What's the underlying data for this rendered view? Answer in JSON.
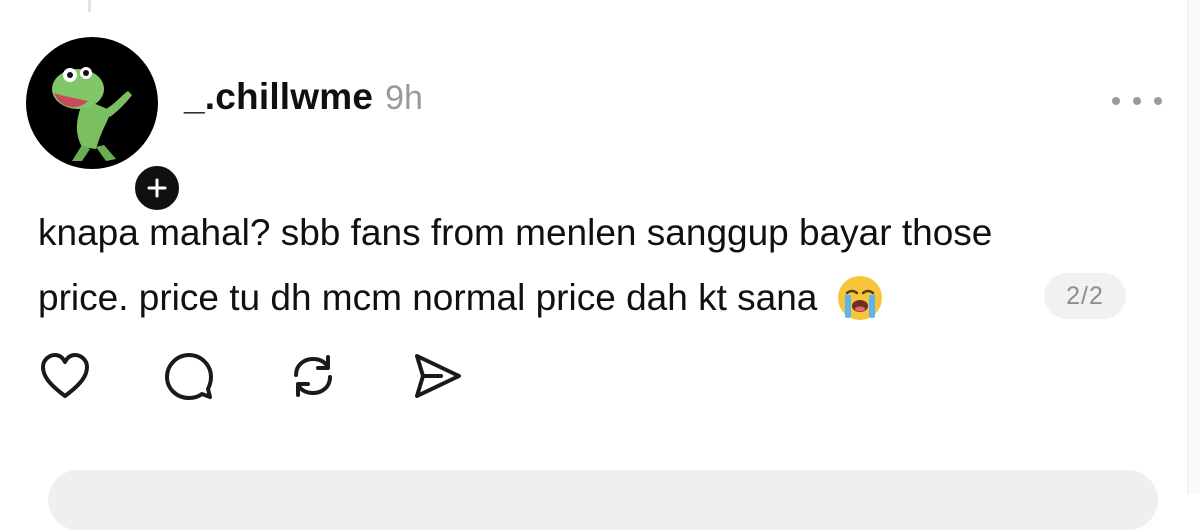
{
  "post": {
    "username": "_.chillwme",
    "timestamp": "9h",
    "text_lines": [
      "knapa mahal? sbb fans from menlen sanggup bayar those",
      "price. price tu dh mcm normal price dah kt sana"
    ],
    "trailing_emoji": "loudly-crying-face",
    "page_counter": "2/2"
  },
  "icons": {
    "avatar": "green-frog-avatar",
    "follow": "plus-icon",
    "more": "more-horizontal-icon",
    "like": "heart-icon",
    "reply": "comment-icon",
    "repost": "repost-icon",
    "share": "share-icon"
  },
  "colors": {
    "text": "#101010",
    "muted": "#9a9a9a",
    "avatar_bg": "#000000",
    "frog_green": "#7bbf63",
    "counter_bg": "#f1f1f1"
  }
}
